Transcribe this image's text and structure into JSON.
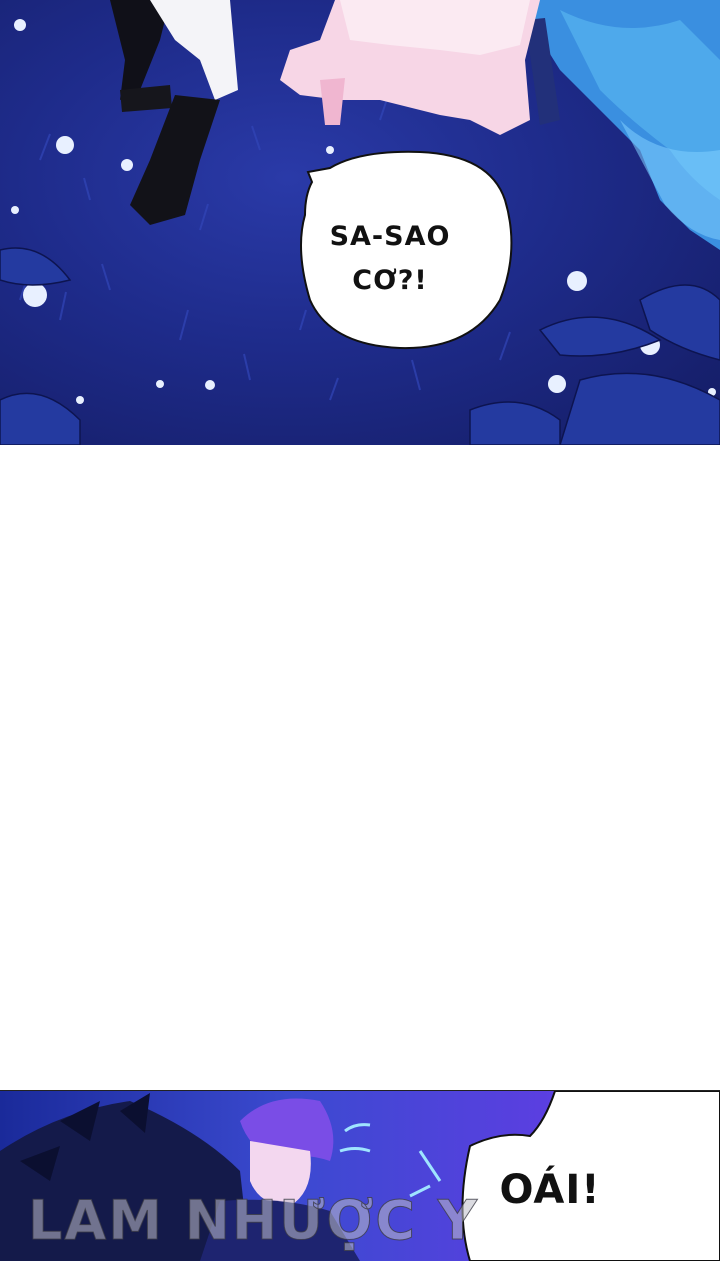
{
  "bubbles": [
    {
      "text_line1": "SA-SAO",
      "text_line2": "CƠ?!"
    },
    {
      "text": "OÁI!"
    }
  ],
  "watermark": "LAM NHƯỢC Y",
  "colors": {
    "night_field": "#1e2b8a",
    "tree_blue": "#3a8fe0",
    "dress_pink": "#f7d6e6",
    "purple_bg": "#6a48f0",
    "flower_white": "#e8f0ff"
  }
}
